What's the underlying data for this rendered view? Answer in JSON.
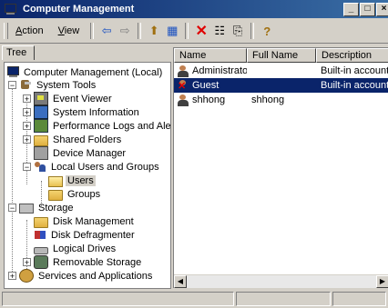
{
  "window": {
    "title": "Computer Management",
    "buttons": [
      "_",
      "□",
      "×"
    ]
  },
  "menu": {
    "action": {
      "accel": "A",
      "rest": "ction"
    },
    "view": {
      "accel": "V",
      "rest": "iew"
    }
  },
  "toolbar": {
    "icons": [
      "back-arrow-icon",
      "forward-arrow-icon",
      "up-folder-icon",
      "show-hide-tree-icon",
      "delete-icon",
      "properties-icon",
      "export-list-icon",
      "help-icon"
    ],
    "glyphs": {
      "back": "⇦",
      "forward": "⇨",
      "up": "⬆",
      "tree": "▦",
      "delete": "✕",
      "properties": "☷",
      "export": "⎘",
      "help": "?"
    }
  },
  "tree_tab": {
    "label": "Tree"
  },
  "tree": {
    "items": [
      {
        "label": "Computer Management (Local)"
      },
      {
        "label": "System Tools"
      },
      {
        "label": "Event Viewer"
      },
      {
        "label": "System Information"
      },
      {
        "label": "Performance Logs and Alerts"
      },
      {
        "label": "Shared Folders"
      },
      {
        "label": "Device Manager"
      },
      {
        "label": "Local Users and Groups"
      },
      {
        "label": "Users"
      },
      {
        "label": "Groups"
      },
      {
        "label": "Storage"
      },
      {
        "label": "Disk Management"
      },
      {
        "label": "Disk Defragmenter"
      },
      {
        "label": "Logical Drives"
      },
      {
        "label": "Removable Storage"
      },
      {
        "label": "Services and Applications"
      }
    ],
    "selected": "Users"
  },
  "list": {
    "columns": [
      "Name",
      "Full Name",
      "Description"
    ],
    "rows": [
      {
        "name": "Administrator",
        "full_name": "",
        "description": "Built-in account for a"
      },
      {
        "name": "Guest",
        "full_name": "",
        "description": "Built-in account for g"
      },
      {
        "name": "shhong",
        "full_name": "shhong",
        "description": ""
      }
    ],
    "selected_row": "Guest"
  },
  "colors": {
    "title_bar": "#0a246a",
    "selection": "#0a246a",
    "chrome": "#d4d0c8"
  }
}
